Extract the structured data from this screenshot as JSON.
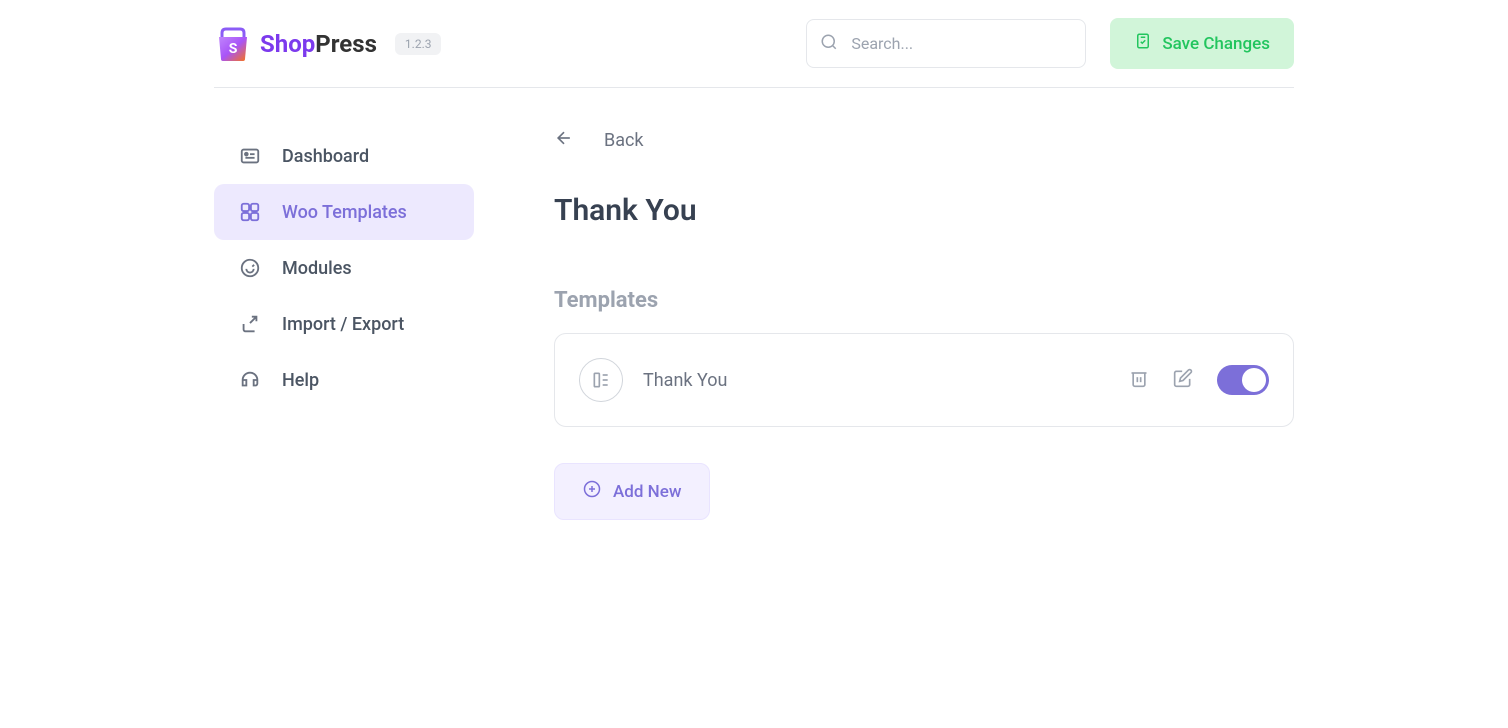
{
  "header": {
    "logo": {
      "shop": "Shop",
      "press": "Press"
    },
    "version": "1.2.3",
    "search_placeholder": "Search...",
    "save_label": "Save Changes"
  },
  "sidebar": {
    "items": [
      {
        "label": "Dashboard",
        "active": false
      },
      {
        "label": "Woo Templates",
        "active": true
      },
      {
        "label": "Modules",
        "active": false
      },
      {
        "label": "Import / Export",
        "active": false
      },
      {
        "label": "Help",
        "active": false
      }
    ]
  },
  "content": {
    "back_label": "Back",
    "page_title": "Thank You",
    "section_title": "Templates",
    "templates": [
      {
        "name": "Thank You",
        "enabled": true
      }
    ],
    "add_new_label": "Add New"
  }
}
